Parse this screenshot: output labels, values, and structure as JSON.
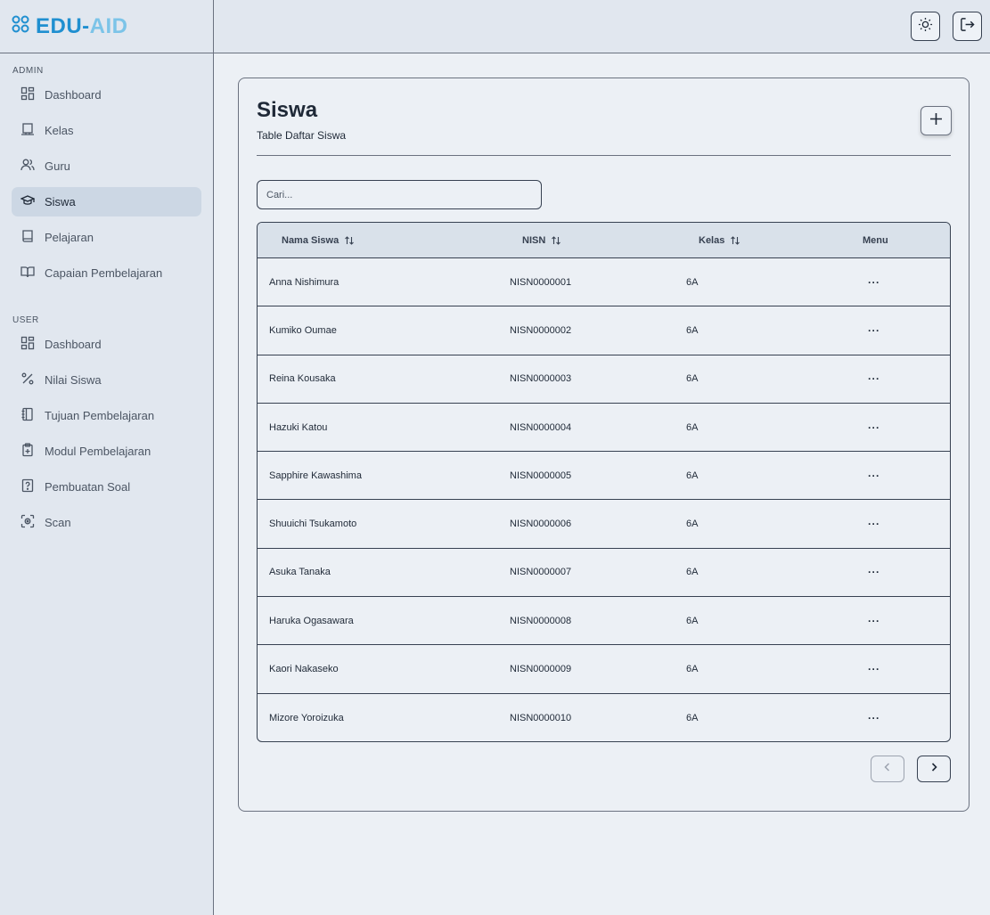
{
  "brand": {
    "part1": "EDU-",
    "part2": "AID"
  },
  "sidebar": {
    "admin_label": "ADMIN",
    "admin_items": [
      {
        "label": "Dashboard",
        "icon": "dashboard-icon"
      },
      {
        "label": "Kelas",
        "icon": "classroom-icon"
      },
      {
        "label": "Guru",
        "icon": "users-icon"
      },
      {
        "label": "Siswa",
        "icon": "graduation-cap-icon",
        "active": true
      },
      {
        "label": "Pelajaran",
        "icon": "book-icon"
      },
      {
        "label": "Capaian Pembelajaran",
        "icon": "book-open-icon"
      }
    ],
    "user_label": "USER",
    "user_items": [
      {
        "label": "Dashboard",
        "icon": "dashboard-icon"
      },
      {
        "label": "Nilai Siswa",
        "icon": "percent-icon"
      },
      {
        "label": "Tujuan Pembelajaran",
        "icon": "notebook-icon"
      },
      {
        "label": "Modul Pembelajaran",
        "icon": "clipboard-plus-icon"
      },
      {
        "label": "Pembuatan Soal",
        "icon": "question-file-icon"
      },
      {
        "label": "Scan",
        "icon": "scan-icon"
      }
    ]
  },
  "page": {
    "title": "Siswa",
    "subtitle": "Table Daftar Siswa",
    "search_placeholder": "Cari..."
  },
  "table": {
    "columns": [
      "Nama Siswa",
      "NISN",
      "Kelas",
      "Menu"
    ],
    "rows": [
      {
        "nama": "Anna Nishimura",
        "nisn": "NISN0000001",
        "kelas": "6A",
        "menu": "···"
      },
      {
        "nama": "Kumiko Oumae",
        "nisn": "NISN0000002",
        "kelas": "6A",
        "menu": "···"
      },
      {
        "nama": "Reina Kousaka",
        "nisn": "NISN0000003",
        "kelas": "6A",
        "menu": "···"
      },
      {
        "nama": "Hazuki Katou",
        "nisn": "NISN0000004",
        "kelas": "6A",
        "menu": "···"
      },
      {
        "nama": "Sapphire Kawashima",
        "nisn": "NISN0000005",
        "kelas": "6A",
        "menu": "···"
      },
      {
        "nama": "Shuuichi Tsukamoto",
        "nisn": "NISN0000006",
        "kelas": "6A",
        "menu": "···"
      },
      {
        "nama": "Asuka Tanaka",
        "nisn": "NISN0000007",
        "kelas": "6A",
        "menu": "···"
      },
      {
        "nama": "Haruka Ogasawara",
        "nisn": "NISN0000008",
        "kelas": "6A",
        "menu": "···"
      },
      {
        "nama": "Kaori Nakaseko",
        "nisn": "NISN0000009",
        "kelas": "6A",
        "menu": "···"
      },
      {
        "nama": "Mizore Yoroizuka",
        "nisn": "NISN0000010",
        "kelas": "6A",
        "menu": "···"
      }
    ]
  },
  "colors": {
    "brand_primary": "#1f8fd0",
    "brand_secondary": "#7cc4e8",
    "active_nav": "#ccd7e4"
  }
}
